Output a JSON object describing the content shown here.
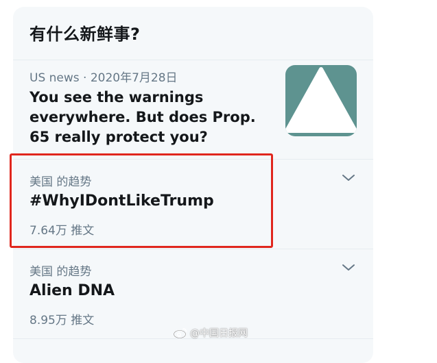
{
  "panel": {
    "title": "有什么新鲜事?"
  },
  "news": {
    "meta": "US news · 2020年7月28日",
    "headline": "You see the warnings everywhere. But does Prop. 65 really protect you?",
    "thumbnail_icon": "warning-triangle-icon",
    "thumbnail_color": "#5e9390"
  },
  "trends": [
    {
      "context": "美国 的趋势",
      "name": "#WhyIDontLikeTrump",
      "count": "7.64万 推文"
    },
    {
      "context": "美国 的趋势",
      "name": "Alien DNA",
      "count": "8.95万 推文"
    }
  ],
  "highlight": {
    "color": "#e0261d"
  },
  "watermark": {
    "icon": "weibo-icon",
    "text": "@中国日报网"
  }
}
